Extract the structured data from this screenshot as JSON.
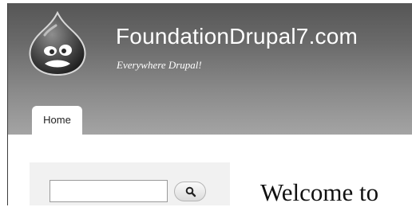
{
  "header": {
    "site_name": "FoundationDrupal7.com",
    "slogan": "Everywhere Drupal!",
    "logo_icon": "drupal-drop-icon"
  },
  "nav": {
    "tabs": [
      {
        "label": "Home",
        "active": true
      }
    ]
  },
  "sidebar": {
    "search": {
      "value": "",
      "button_icon": "magnifier-icon"
    }
  },
  "main": {
    "title_visible": "Welcome to"
  },
  "colors": {
    "header_top": "#565656",
    "header_bottom": "#a4a4a4",
    "sidebar_bg": "#f1f1f1",
    "text_dark": "#111111"
  }
}
